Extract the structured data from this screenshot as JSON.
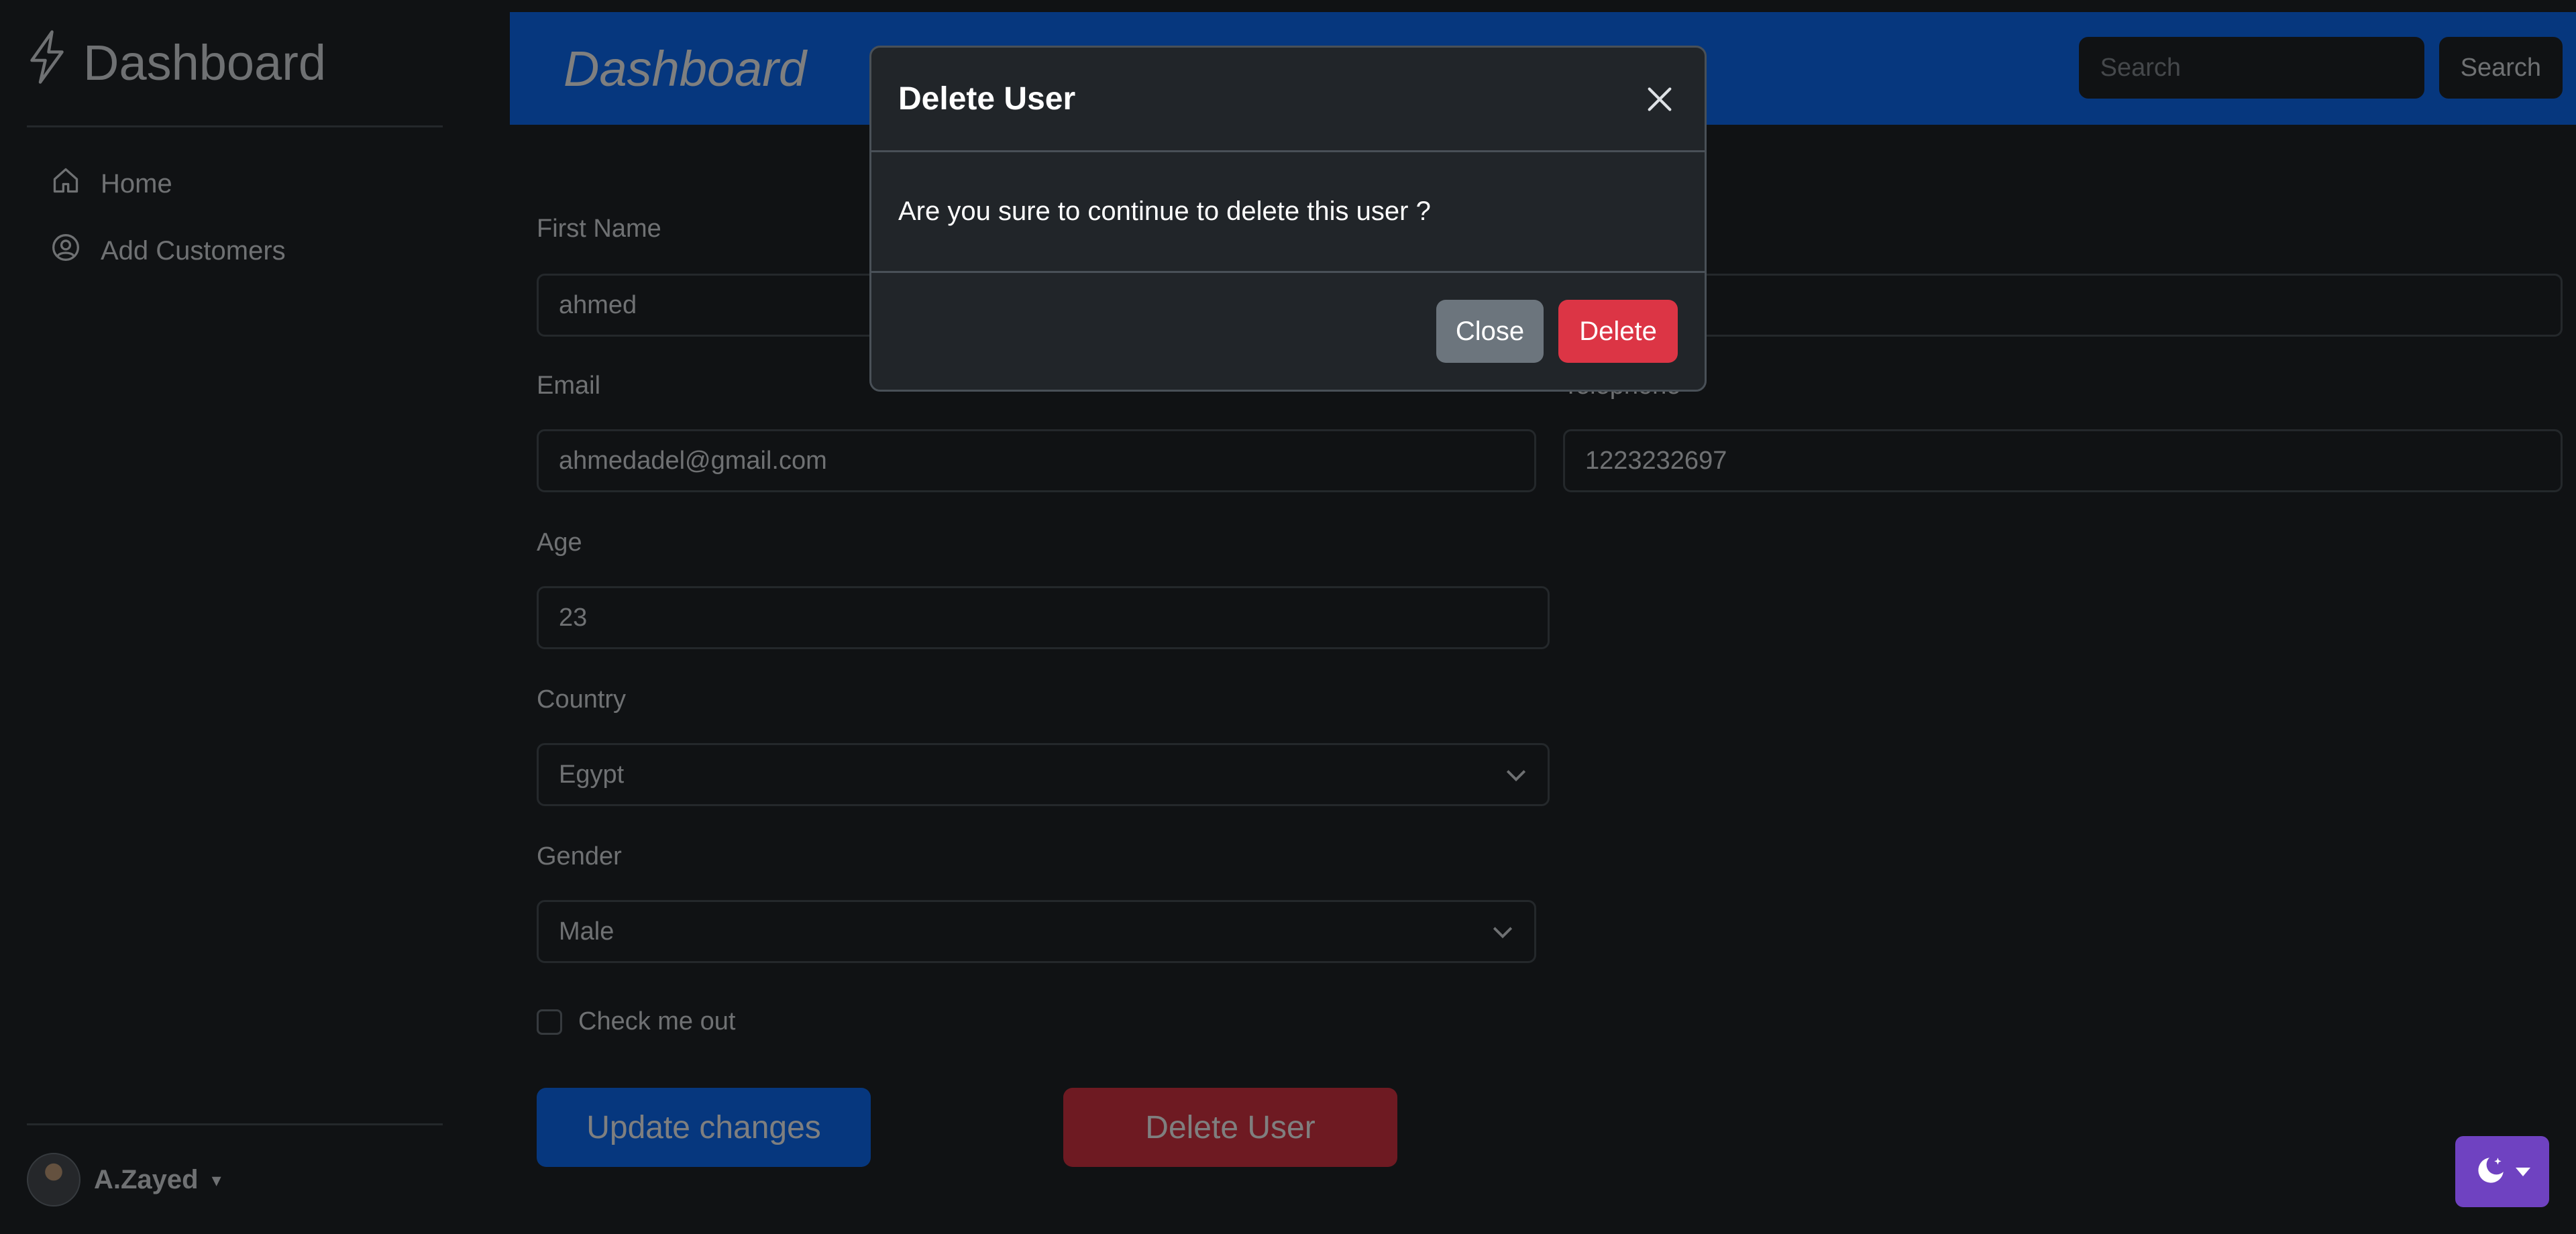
{
  "sidebar": {
    "brand": "Dashboard",
    "items": [
      {
        "label": "Home",
        "icon": "home-icon"
      },
      {
        "label": "Add Customers",
        "icon": "user-circle-icon"
      }
    ],
    "user": {
      "name": "A.Zayed"
    }
  },
  "topbar": {
    "title": "Dashboard",
    "search_placeholder": "Search",
    "search_button": "Search"
  },
  "form": {
    "first_name": {
      "label": "First Name",
      "value": "ahmed"
    },
    "email": {
      "label": "Email",
      "value": "ahmedadel@gmail.com"
    },
    "telephone": {
      "label": "Telephone",
      "value": "1223232697"
    },
    "age": {
      "label": "Age",
      "value": "23"
    },
    "country": {
      "label": "Country",
      "value": "Egypt"
    },
    "gender": {
      "label": "Gender",
      "value": "Male"
    },
    "check": {
      "label": "Check me out"
    },
    "update_button": "Update changes",
    "delete_button": "Delete User"
  },
  "modal": {
    "title": "Delete User",
    "message": "Are you sure to continue to delete this user ?",
    "close_button": "Close",
    "delete_button": "Delete"
  },
  "colors": {
    "primary": "#0d6efd",
    "danger": "#dc3545",
    "secondary": "#6c757d",
    "theme_toggle": "#6f42c1",
    "background": "#212529"
  }
}
